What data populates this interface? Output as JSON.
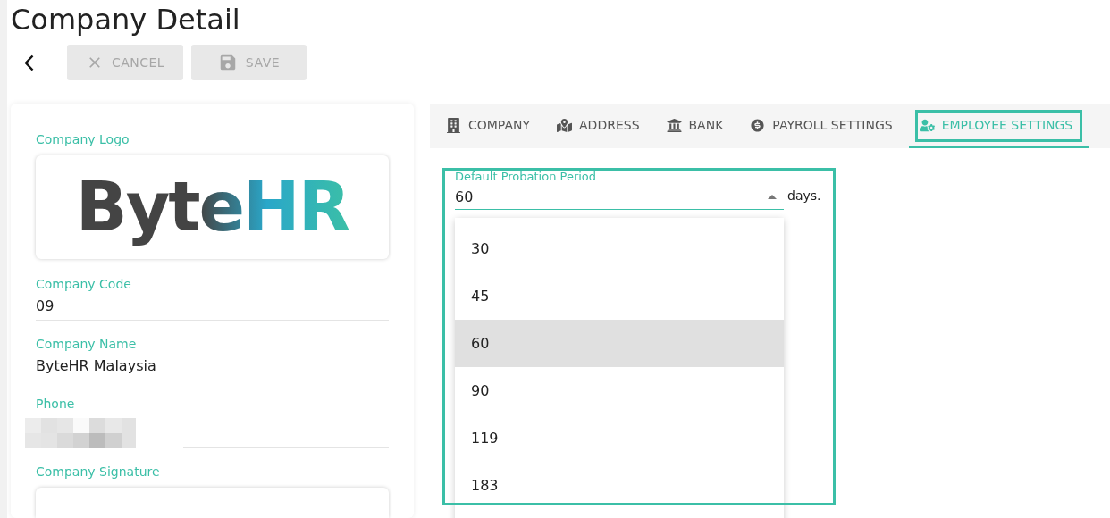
{
  "page_title": "Company Detail",
  "toolbar": {
    "buttons": [
      {
        "kind": "back",
        "disabled": false
      },
      {
        "kind": "cancel",
        "label": "CANCEL",
        "disabled": true
      },
      {
        "kind": "save",
        "label": "SAVE",
        "disabled": true
      }
    ]
  },
  "company_card": {
    "logo_label": "Company Logo",
    "logo_text": "ByteHR",
    "fields": [
      {
        "kind": "text",
        "label": "Company Code",
        "value": "09"
      },
      {
        "kind": "text",
        "label": "Company Name",
        "value": "ByteHR Malaysia"
      },
      {
        "kind": "blurred",
        "label": "Phone"
      }
    ],
    "signature_label": "Company Signature"
  },
  "tabs": [
    {
      "label": "COMPANY",
      "selected": false
    },
    {
      "label": "ADDRESS",
      "selected": false
    },
    {
      "label": "BANK",
      "selected": false
    },
    {
      "label": "PAYROLL SETTINGS",
      "selected": false
    },
    {
      "label": "EMPLOYEE SETTINGS",
      "selected": true
    }
  ],
  "probation": {
    "label": "Default Probation Period",
    "value": "60",
    "suffix": "days.",
    "expanded": true,
    "options": [
      {
        "label": "30",
        "selected": false
      },
      {
        "label": "45",
        "selected": false
      },
      {
        "label": "60",
        "selected": true
      },
      {
        "label": "90",
        "selected": false
      },
      {
        "label": "119",
        "selected": false
      },
      {
        "label": "183",
        "selected": false
      }
    ]
  }
}
